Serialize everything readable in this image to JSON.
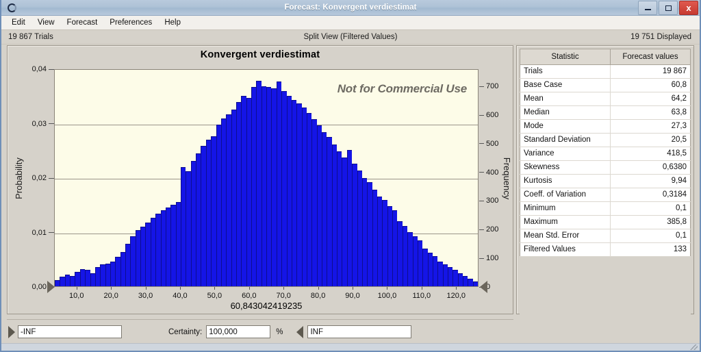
{
  "window": {
    "title": "Forecast: Konvergent verdiestimat",
    "icon": "crystal-ball-icon",
    "controls": {
      "minimize": "–",
      "maximize": "□",
      "close": "x"
    }
  },
  "menu": {
    "items": [
      "Edit",
      "View",
      "Forecast",
      "Preferences",
      "Help"
    ]
  },
  "infobar": {
    "trials": "19 867 Trials",
    "view_mode": "Split View (Filtered Values)",
    "displayed": "19 751 Displayed"
  },
  "chart_data": {
    "type": "bar",
    "title": "Konvergent verdiestimat",
    "watermark": "Not for Commercial Use",
    "xlabel": "",
    "ylabel": "Probability",
    "y2label": "Frequency",
    "grid": true,
    "legend": null,
    "xlim": [
      3.5,
      126.5
    ],
    "ylim": [
      0,
      0.04
    ],
    "y2lim": [
      0,
      760
    ],
    "xtick_labels": [
      "10,0",
      "20,0",
      "30,0",
      "40,0",
      "50,0",
      "60,0",
      "70,0",
      "80,0",
      "90,0",
      "100,0",
      "110,0",
      "120,0"
    ],
    "xtick_values": [
      10,
      20,
      30,
      40,
      50,
      60,
      70,
      80,
      90,
      100,
      110,
      120
    ],
    "ytick_labels": [
      "0,00",
      "0,01",
      "0,02",
      "0,03",
      "0,04"
    ],
    "ytick_values": [
      0,
      0.01,
      0.02,
      0.03,
      0.04
    ],
    "y2tick_labels": [
      "0",
      "100",
      "200",
      "300",
      "400",
      "500",
      "600",
      "700"
    ],
    "y2tick_values": [
      0,
      100,
      200,
      300,
      400,
      500,
      600,
      700
    ],
    "center_value_label": "60,843042419235",
    "bin_count": 64,
    "values": [
      0.0012,
      0.0018,
      0.0021,
      0.0019,
      0.0026,
      0.0032,
      0.003,
      0.0024,
      0.0036,
      0.004,
      0.0042,
      0.0046,
      0.0055,
      0.0063,
      0.0078,
      0.0092,
      0.0104,
      0.011,
      0.0118,
      0.0126,
      0.0134,
      0.0141,
      0.0146,
      0.0151,
      0.0156,
      0.022,
      0.0213,
      0.0232,
      0.0245,
      0.026,
      0.0271,
      0.0277,
      0.0299,
      0.031,
      0.0318,
      0.0326,
      0.034,
      0.0352,
      0.0348,
      0.0368,
      0.038,
      0.037,
      0.0369,
      0.0366,
      0.0378,
      0.0361,
      0.0352,
      0.0344,
      0.0338,
      0.033,
      0.032,
      0.0309,
      0.0297,
      0.0285,
      0.0276,
      0.0262,
      0.025,
      0.0238,
      0.0252,
      0.0227,
      0.0214,
      0.02,
      0.0192,
      0.0178,
      0.0166,
      0.016,
      0.0148,
      0.014,
      0.012,
      0.0112,
      0.01,
      0.0092,
      0.0085,
      0.007,
      0.0062,
      0.0056,
      0.0046,
      0.0041,
      0.0035,
      0.003,
      0.0024,
      0.0019,
      0.0014,
      0.0009
    ]
  },
  "stats": {
    "header": {
      "statistic": "Statistic",
      "values": "Forecast values"
    },
    "rows": [
      {
        "name": "Trials",
        "value": "19 867"
      },
      {
        "name": "Base Case",
        "value": "60,8"
      },
      {
        "name": "Mean",
        "value": "64,2"
      },
      {
        "name": "Median",
        "value": "63,8"
      },
      {
        "name": "Mode",
        "value": "27,3"
      },
      {
        "name": "Standard Deviation",
        "value": "20,5"
      },
      {
        "name": "Variance",
        "value": "418,5"
      },
      {
        "name": "Skewness",
        "value": "0,6380"
      },
      {
        "name": "Kurtosis",
        "value": "9,94"
      },
      {
        "name": "Coeff. of Variation",
        "value": "0,3184"
      },
      {
        "name": "Minimum",
        "value": "0,1"
      },
      {
        "name": "Maximum",
        "value": "385,8"
      },
      {
        "name": "Mean Std. Error",
        "value": "0,1"
      },
      {
        "name": "Filtered Values",
        "value": "133"
      }
    ]
  },
  "controls": {
    "lower_bound_value": "-INF",
    "certainty_label": "Certainty:",
    "certainty_value": "100,000",
    "percent_label": "%",
    "upper_bound_value": "INF"
  },
  "colors": {
    "bar": "#1515e6",
    "bar_edge": "#0d0d8f",
    "plot_bg": "#fdfce8",
    "window_bg": "#d6d2ca",
    "title_text": "#ffffff",
    "close_button": "#c63a31"
  }
}
